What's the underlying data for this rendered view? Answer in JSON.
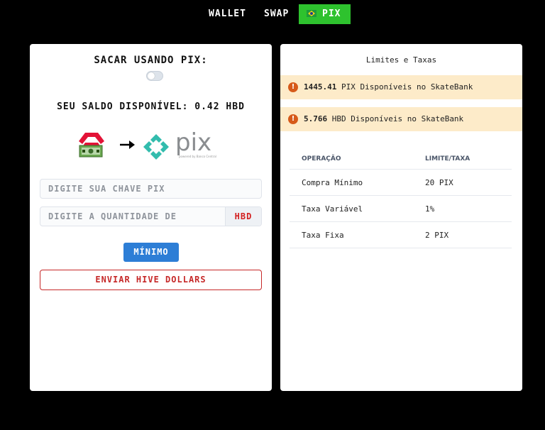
{
  "nav": {
    "wallet": "WALLET",
    "swap": "SWAP",
    "pix": "PIX",
    "active": "PIX",
    "active_color": "#2ec22e"
  },
  "withdraw": {
    "title": "SACAR USANDO PIX:",
    "toggle_on": false,
    "balance": "SEU SALDO DISPONÍVEL: 0.42 HBD",
    "pix_key_placeholder": "DIGITE SUA CHAVE PIX",
    "amount_placeholder": "DIGITE A QUANTIDADE DE",
    "currency": "HBD",
    "min_button": "MÍNIMO",
    "send_button": "ENVIAR HIVE DOLLARS",
    "pix_logo_text": "pix",
    "pix_logo_sub": "powered by Banco Central"
  },
  "limits": {
    "title": "Limites e Taxas",
    "alerts": [
      {
        "amount": "1445.41",
        "text": "PIX Disponíveis no SkateBank"
      },
      {
        "amount": "5.766",
        "text": "HBD Disponíveis no SkateBank"
      }
    ],
    "columns": [
      "OPERAÇÃO",
      "LIMITE/TAXA"
    ],
    "rows": [
      [
        "Compra Mínimo",
        "20 PIX"
      ],
      [
        "Taxa Variável",
        "1%"
      ],
      [
        "Taxa Fixa",
        "2 PIX"
      ]
    ]
  },
  "colors": {
    "accent_green": "#2ec22e",
    "button_blue": "#2d7ed6",
    "danger_red": "#c62828",
    "alert_bg": "#fdebc9"
  }
}
